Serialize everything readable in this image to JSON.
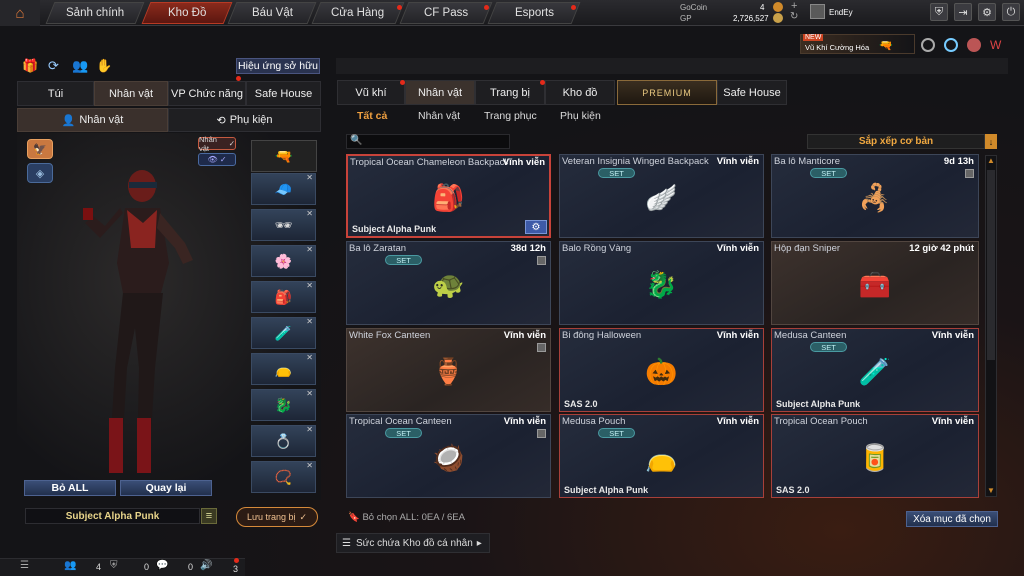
{
  "nav": {
    "tabs": [
      "Sảnh chính",
      "Kho Đồ",
      "Báu Vật",
      "Cửa Hàng",
      "CF Pass",
      "Esports"
    ],
    "active": "Kho Đồ"
  },
  "currency": {
    "gocoin_label": "GoCoin",
    "gocoin_value": "4",
    "gp_label": "GP",
    "gp_value": "2,726,527"
  },
  "user": {
    "name": "EndEy"
  },
  "promo": {
    "badge": "NEW",
    "label": "Vũ Khí Cường Hóa"
  },
  "left": {
    "effects_button": "Hiệu ứng sở hữu",
    "tabs": [
      "Túi",
      "Nhân vật",
      "VP Chức năng",
      "Safe House"
    ],
    "subtabs": [
      "Nhân vật",
      "Phụ kiện"
    ],
    "char_toggle": "Nhân vật",
    "buttons": {
      "clear": "Bỏ ALL",
      "back": "Quay lại"
    },
    "character_name": "Subject Alpha Punk",
    "save_button": "Lưu trang bị"
  },
  "right": {
    "tabs": [
      "Vũ khí",
      "Nhân vật",
      "Trang bị",
      "Kho đồ",
      "PREMIUM",
      "Safe House"
    ],
    "subtabs": [
      "Tất cả",
      "Nhân vật",
      "Trang phục",
      "Phụ kiện"
    ],
    "sort": "Sắp xếp cơ bản",
    "items": [
      {
        "name": "Tropical Ocean Chameleon Backpack",
        "duration": "Vĩnh viễn",
        "footer": "Subject Alpha Punk",
        "set": false,
        "icon": "🎒"
      },
      {
        "name": "Veteran Insignia Winged Backpack",
        "duration": "Vĩnh viễn",
        "footer": "",
        "set": true,
        "icon": "🪽"
      },
      {
        "name": "Ba lô Manticore",
        "duration": "9d 13h",
        "footer": "",
        "set": true,
        "icon": "🦂"
      },
      {
        "name": "Ba lô Zaratan",
        "duration": "38d 12h",
        "footer": "",
        "set": true,
        "icon": "🐢"
      },
      {
        "name": "Balo Rồng Vàng",
        "duration": "Vĩnh viễn",
        "footer": "",
        "set": false,
        "icon": "🐉"
      },
      {
        "name": "Hộp đạn Sniper",
        "duration": "12 giờ 42 phút",
        "footer": "",
        "set": false,
        "icon": "🧰"
      },
      {
        "name": "White Fox Canteen",
        "duration": "Vĩnh viễn",
        "footer": "",
        "set": false,
        "icon": "🏺"
      },
      {
        "name": "Bi đông Halloween",
        "duration": "Vĩnh viễn",
        "footer": "SAS 2.0",
        "set": false,
        "icon": "🎃"
      },
      {
        "name": "Medusa Canteen",
        "duration": "Vĩnh viễn",
        "footer": "Subject Alpha Punk",
        "set": true,
        "icon": "🧪"
      },
      {
        "name": "Tropical Ocean Canteen",
        "duration": "Vĩnh viễn",
        "footer": "",
        "set": true,
        "icon": "🥥"
      },
      {
        "name": "Medusa Pouch",
        "duration": "Vĩnh viễn",
        "footer": "Subject Alpha Punk",
        "set": true,
        "icon": "👝"
      },
      {
        "name": "Tropical Ocean Pouch",
        "duration": "Vĩnh viễn",
        "footer": "SAS 2.0",
        "set": false,
        "icon": "🥫"
      }
    ],
    "set_label": "SET",
    "unequip_count": "Bỏ chọn ALL: 0EA / 6EA",
    "clear_selected": "Xóa mục đã chọn",
    "capacity": "Sức chứa Kho đồ cá nhân"
  },
  "bottom": {
    "friends": "4",
    "mail": "0",
    "chat": "0",
    "notif": "3"
  }
}
